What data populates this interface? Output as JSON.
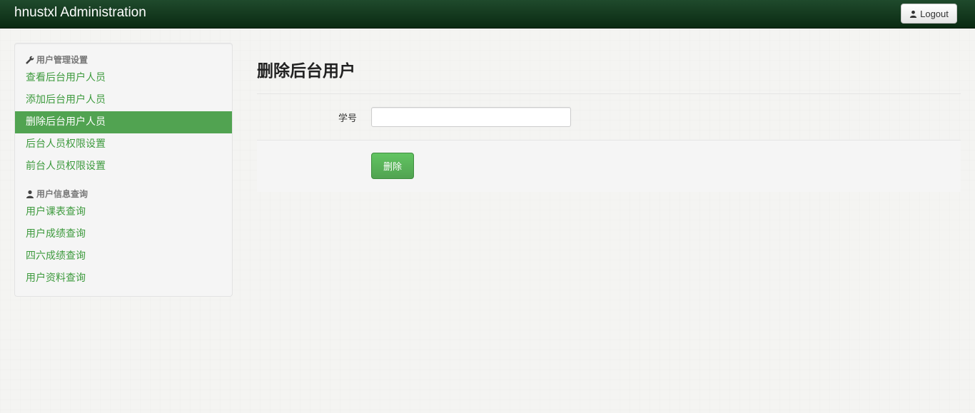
{
  "app": {
    "title": "hnustxl Administration",
    "logout_label": "Logout"
  },
  "sidebar": {
    "sections": [
      {
        "header": "用户管理设置",
        "icon": "wrench-icon",
        "items": [
          {
            "label": "查看后台用户人员",
            "active": false
          },
          {
            "label": "添加后台用户人员",
            "active": false
          },
          {
            "label": "删除后台用户人员",
            "active": true
          },
          {
            "label": "后台人员权限设置",
            "active": false
          },
          {
            "label": "前台人员权限设置",
            "active": false
          }
        ]
      },
      {
        "header": "用户信息查询",
        "icon": "user-icon",
        "items": [
          {
            "label": "用户课表查询",
            "active": false
          },
          {
            "label": "用户成绩查询",
            "active": false
          },
          {
            "label": "四六成绩查询",
            "active": false
          },
          {
            "label": "用户资料查询",
            "active": false
          }
        ]
      }
    ]
  },
  "main": {
    "title": "删除后台用户",
    "form": {
      "student_id_label": "学号",
      "student_id_value": "",
      "delete_label": "删除"
    }
  },
  "colors": {
    "navbar": "#0f3319",
    "accent": "#51a351",
    "link": "#3d9a3d"
  }
}
